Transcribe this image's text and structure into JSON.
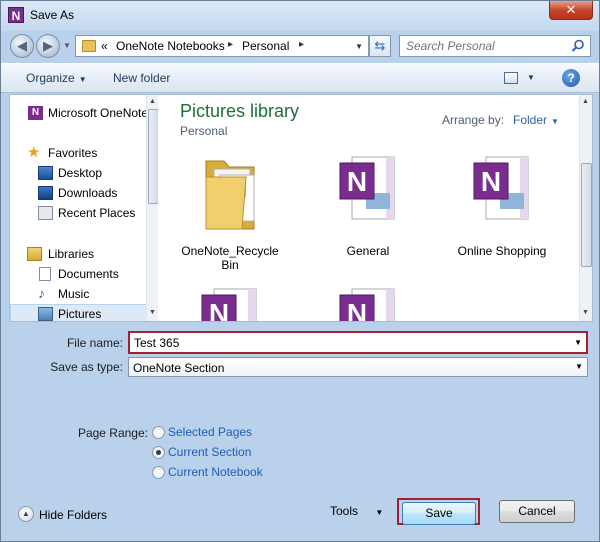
{
  "window": {
    "title": "Save As",
    "app_icon_letter": "N",
    "close_symbol": "✕"
  },
  "address_bar": {
    "overflow": "«",
    "breadcrumbs": [
      "OneNote Notebooks",
      "Personal"
    ],
    "separator": "▸",
    "search_placeholder": "Search Personal"
  },
  "toolbar": {
    "organize_label": "Organize",
    "new_folder_label": "New folder",
    "help_symbol": "?"
  },
  "nav_pane": {
    "items": [
      {
        "label": "Microsoft OneNote",
        "icon": "onenote-icon"
      },
      {
        "label": "Favorites",
        "icon": "star-icon"
      },
      {
        "label": "Desktop",
        "icon": "desktop-icon"
      },
      {
        "label": "Downloads",
        "icon": "downloads-icon"
      },
      {
        "label": "Recent Places",
        "icon": "recent-places-icon"
      },
      {
        "label": "Libraries",
        "icon": "libraries-icon"
      },
      {
        "label": "Documents",
        "icon": "documents-icon"
      },
      {
        "label": "Music",
        "icon": "music-icon"
      },
      {
        "label": "Pictures",
        "icon": "pictures-icon",
        "selected": true
      }
    ]
  },
  "library": {
    "title": "Pictures library",
    "subtitle": "Personal",
    "arrange_label": "Arrange by:",
    "arrange_value": "Folder"
  },
  "files": [
    {
      "name": "OneNote_Recycle Bin",
      "icon": "folder-icon"
    },
    {
      "name": "General",
      "icon": "onenote-section-icon"
    },
    {
      "name": "Online Shopping",
      "icon": "onenote-section-icon"
    },
    {
      "name": "",
      "icon": "onenote-section-icon"
    },
    {
      "name": "",
      "icon": "onenote-section-icon"
    }
  ],
  "form": {
    "file_name_label": "File name:",
    "file_name_value": "Test 365",
    "save_as_type_label": "Save as type:",
    "save_as_type_value": "OneNote Section",
    "page_range_label": "Page Range:",
    "page_range_options": [
      {
        "label": "Selected Pages",
        "checked": false
      },
      {
        "label": "Current Section",
        "checked": true
      },
      {
        "label": "Current Notebook",
        "checked": false
      }
    ]
  },
  "footer": {
    "hide_folders_label": "Hide Folders",
    "tools_label": "Tools",
    "save_label": "Save",
    "cancel_label": "Cancel"
  },
  "colors": {
    "highlight_border": "#a5202e",
    "library_title": "#1e6e3a",
    "link_blue": "#1f5eb8",
    "onenote_purple": "#7a2c8f"
  }
}
